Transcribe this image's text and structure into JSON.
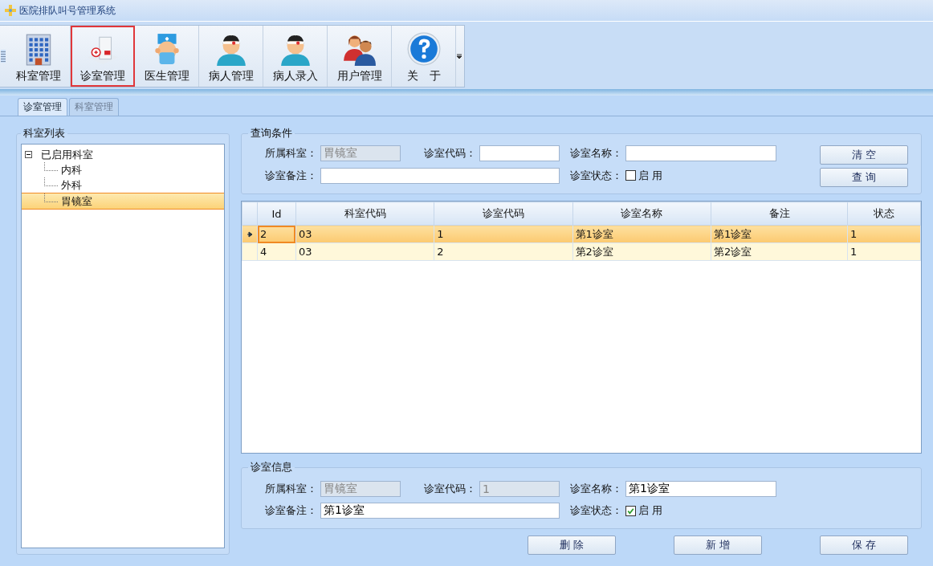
{
  "window": {
    "title": "医院排队叫号管理系统"
  },
  "toolbar": {
    "items": [
      {
        "label": "科室管理",
        "kind": "building",
        "selected": false
      },
      {
        "label": "诊室管理",
        "kind": "clinic",
        "selected": true
      },
      {
        "label": "医生管理",
        "kind": "doctor",
        "selected": false
      },
      {
        "label": "病人管理",
        "kind": "patient",
        "selected": false
      },
      {
        "label": "病人录入",
        "kind": "patient",
        "selected": false
      },
      {
        "label": "用户管理",
        "kind": "users",
        "selected": false
      },
      {
        "label": "关　于",
        "kind": "help",
        "selected": false
      }
    ]
  },
  "tabs": [
    {
      "label": "诊室管理",
      "selected": true
    },
    {
      "label": "科室管理",
      "selected": false
    }
  ],
  "tree": {
    "title": "科室列表",
    "items": [
      {
        "label": "已启用科室",
        "expanded": true,
        "selected": false,
        "children": [
          {
            "label": "内科",
            "selected": false
          },
          {
            "label": "外科",
            "selected": false
          },
          {
            "label": "胃镜室",
            "selected": true
          }
        ]
      }
    ]
  },
  "query": {
    "title": "查询条件",
    "fields": [
      {
        "kind": "text",
        "label": "所属科室：",
        "value": "胃镜室",
        "disabled": true
      },
      {
        "kind": "text",
        "label": "诊室代码：",
        "disabled": false
      },
      {
        "kind": "text",
        "label": "诊室名称：",
        "disabled": false
      },
      {
        "kind": "text",
        "label": "诊室备注：",
        "disabled": false
      },
      {
        "kind": "checkbox",
        "label": "诊室状态：",
        "text": "启 用",
        "checked": false
      }
    ],
    "buttons": [
      "清 空",
      "查 询"
    ]
  },
  "table": {
    "columns": [
      "Id",
      "科室代码",
      "诊室代码",
      "诊室名称",
      "备注",
      "状态"
    ],
    "rows": [
      {
        "cells": [
          "2",
          "03",
          "1",
          "第1诊室",
          "第1诊室",
          "1"
        ],
        "selected": true
      },
      {
        "cells": [
          "4",
          "03",
          "2",
          "第2诊室",
          "第2诊室",
          "1"
        ],
        "selected": false
      }
    ]
  },
  "info": {
    "title": "诊室信息",
    "fields": [
      {
        "kind": "text",
        "label": "所属科室：",
        "value": "胃镜室",
        "disabled": true
      },
      {
        "kind": "text",
        "label": "诊室代码：",
        "value": "1",
        "disabled": true
      },
      {
        "kind": "text",
        "label": "诊室名称：",
        "value": "第1诊室",
        "disabled": false
      },
      {
        "kind": "text",
        "label": "诊室备注：",
        "value": "第1诊室",
        "disabled": false
      },
      {
        "kind": "checkbox",
        "label": "诊室状态：",
        "text": "启 用",
        "checked": true
      }
    ]
  },
  "actions": [
    "删 除",
    "新 增",
    "保 存"
  ]
}
